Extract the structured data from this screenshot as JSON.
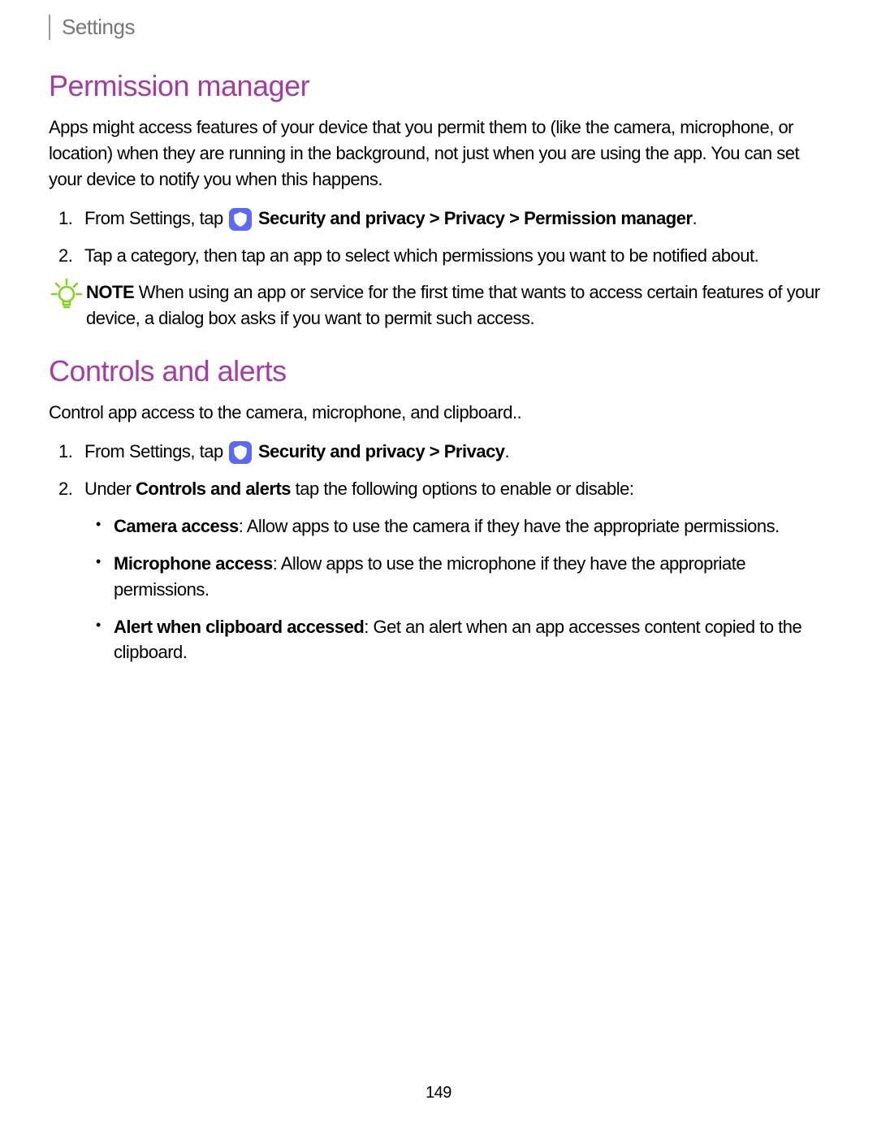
{
  "breadcrumb": "Settings",
  "section1": {
    "heading": "Permission manager",
    "intro": "Apps might access features of your device that you permit them to (like the camera, microphone, or location) when they are running in the background, not just when you are using the app. You can set your device to notify you when this happens.",
    "step1_pre": "From Settings, tap ",
    "step1_bold": " Security and privacy > Privacy > Permission manager",
    "step1_post": ".",
    "step2": "Tap a category, then tap an app to select which permissions you want to be notified about.",
    "note_label": "NOTE",
    "note_text": "  When using an app or service for the first time that wants to access certain features of your device, a dialog box asks if you want to permit such access."
  },
  "section2": {
    "heading": "Controls and alerts",
    "intro": "Control app access to the camera, microphone, and clipboard..",
    "step1_pre": "From Settings, tap ",
    "step1_bold": " Security and privacy > Privacy",
    "step1_post": ".",
    "step2_pre": "Under ",
    "step2_bold": "Controls and alerts",
    "step2_post": " tap the following options to enable or disable:",
    "bullets": [
      {
        "bold": "Camera access",
        "rest": ": Allow apps to use the camera if they have the appropriate permissions."
      },
      {
        "bold": "Microphone access",
        "rest": ": Allow apps to use the microphone if they have the appropriate permissions."
      },
      {
        "bold": "Alert when clipboard accessed",
        "rest": ": Get an alert when an app accesses content copied to the clipboard."
      }
    ]
  },
  "page_number": "149"
}
